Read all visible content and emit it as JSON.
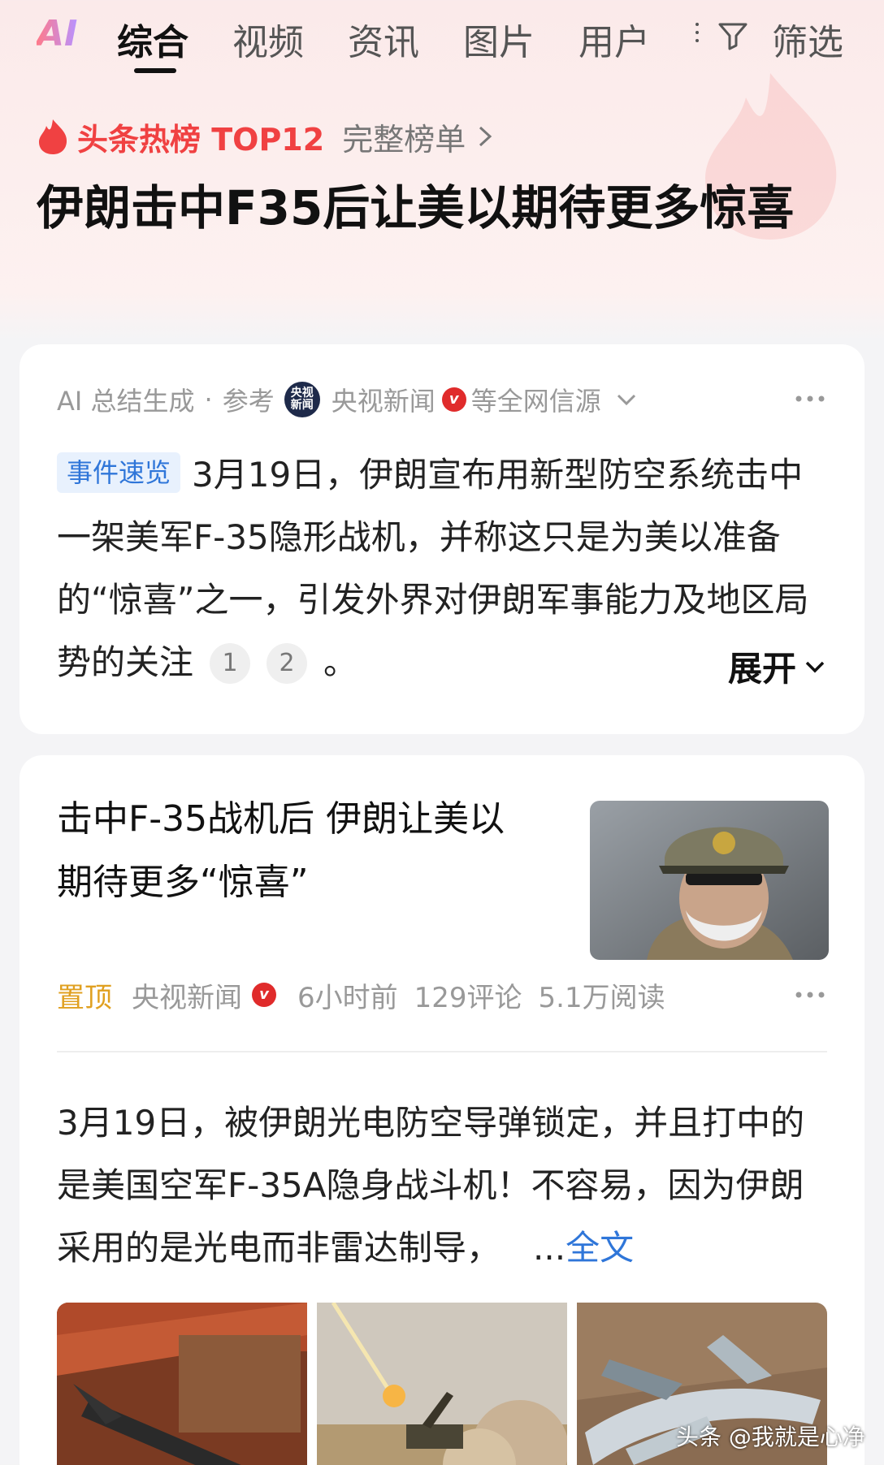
{
  "tabs": {
    "ai": "AI",
    "items": [
      "综合",
      "视频",
      "资讯",
      "图片",
      "用户"
    ],
    "filter": "筛选"
  },
  "hot": {
    "label": "头条热榜 TOP12",
    "full_list": "完整榜单"
  },
  "headline": "伊朗击中F35后让美以期待更多惊喜",
  "summary": {
    "ai_label": "AI 总结生成",
    "ref": "参考",
    "logo_text": "央视新闻",
    "source": "央视新闻",
    "verified": "v",
    "suffix": "等全网信源",
    "tag": "事件速览",
    "text": "3月19日，伊朗宣布用新型防空系统击中一架美军F-35隐形战机，并称这只是为美以准备的“惊喜”之一，引发外界对伊朗军事能力及地区局势的关注",
    "refs": [
      "1",
      "2"
    ],
    "period": "。",
    "expand": "展开"
  },
  "article": {
    "title": "击中F-35战机后 伊朗让美以期待更多“惊喜”",
    "pin": "置顶",
    "source": "央视新闻",
    "verified": "v",
    "time": "6小时前",
    "comments": "129评论",
    "reads": "5.1万阅读",
    "body": "3月19日，被伊朗光电防空导弹锁定，并且打中的是美国空军F-35A隐身战斗机！不容易，因为伊朗采用的是光电而非雷达制导，",
    "ellipsis": "...",
    "full_text": "全文"
  },
  "watermark": "头条 @我就是心净",
  "colors": {
    "accent_red": "#f04142",
    "link_blue": "#2f76d9",
    "pin_orange": "#e0a020"
  }
}
